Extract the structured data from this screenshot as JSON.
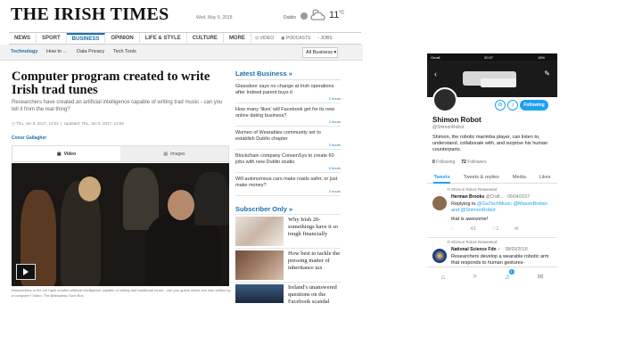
{
  "irish_times": {
    "masthead": "THE IRISH TIMES",
    "date": "Wed, May 9, 2018",
    "weather": {
      "city": "Dublin",
      "temp": "11",
      "unit": "°C"
    },
    "nav": [
      "NEWS",
      "SPORT",
      "BUSINESS",
      "OPINION",
      "LIFE & STYLE",
      "CULTURE",
      "MORE"
    ],
    "nav_extras": [
      "VIDEO",
      "PODCASTS",
      "JOBS"
    ],
    "subnav": [
      "Technology",
      "How to ...",
      "Data Privacy",
      "Tech Tools"
    ],
    "section_select": "All Business",
    "article": {
      "headline": "Computer program created to write Irish trad tunes",
      "standfirst": "Researchers have created an artificial intelligence capable of writing trad music - can you tell it from the real thing?",
      "published": "Thu, Jun 8, 2017, 12:53",
      "updated": "Updated: Thu, Jun 8, 2017, 12:59",
      "author": "Conor Gallagher",
      "media_tabs": [
        "Video",
        "Images"
      ],
      "caption": "Researchers in the UK have created artificial intelligence capable of writing trad traditional music - can you guess which one was written by a computer? Video: The Bellowless Tune Box"
    },
    "latest": {
      "title": "Latest Business »",
      "items": [
        {
          "text": "Glassdoor says no change at Irish operations after Indeed parent buys it",
          "time": "2 hours"
        },
        {
          "text": "How many 'likes' will Facebook get for its new online dating business?",
          "time": "2 hours"
        },
        {
          "text": "Women of Wearables community set to establish Dublin chapter",
          "time": "3 hours"
        },
        {
          "text": "Blockchain company ConsenSys to create 60 jobs with new Dublin studio",
          "time": "3 hours"
        },
        {
          "text": "Will autonomous cars make roads safer, or just make money?",
          "time": "3 hours"
        }
      ]
    },
    "subscriber": {
      "title": "Subscriber Only »",
      "items": [
        {
          "text": "Why Irish 20-somethings have it so tough financially"
        },
        {
          "text": "How best to tackle the pressing matter of inheritance tax"
        },
        {
          "text": "Ireland's unanswered questions on the Facebook scandal"
        }
      ]
    }
  },
  "twitter": {
    "status": {
      "carrier": "Gmail",
      "time": "20:37",
      "battery": "18%"
    },
    "profile": {
      "name": "Shimon Robot",
      "handle": "@ShimonRobot",
      "bio": "Shimon, the robotic marimba player, can listen to, understand, collaborate with, and surprise his human counterparts.",
      "following": "0",
      "following_label": "Following",
      "followers": "72",
      "followers_label": "Followers",
      "follow_button": "Following"
    },
    "tabs": [
      "Tweets",
      "Tweets & replies",
      "Media",
      "Likes"
    ],
    "tweets": [
      {
        "retweet_label": "Shimon Robot Retweeted",
        "author": "Herman Brooks",
        "meta": "@Craft... · 06/04/2017",
        "reply_prefix": "Replying to ",
        "reply_to": "@GaTechMusic @MasonBretan and @ShimonRobot",
        "text": "that is awesome!",
        "retweets": "1",
        "likes": "1"
      },
      {
        "retweet_label": "Shimon Robot Retweeted",
        "author": "National Science Fdn",
        "meta": "· 08/03/2018",
        "text": "Researchers develop a wearable robotic arm that responds to human gestures-"
      }
    ],
    "notification_count": "1",
    "accent": "#1da1f2"
  }
}
